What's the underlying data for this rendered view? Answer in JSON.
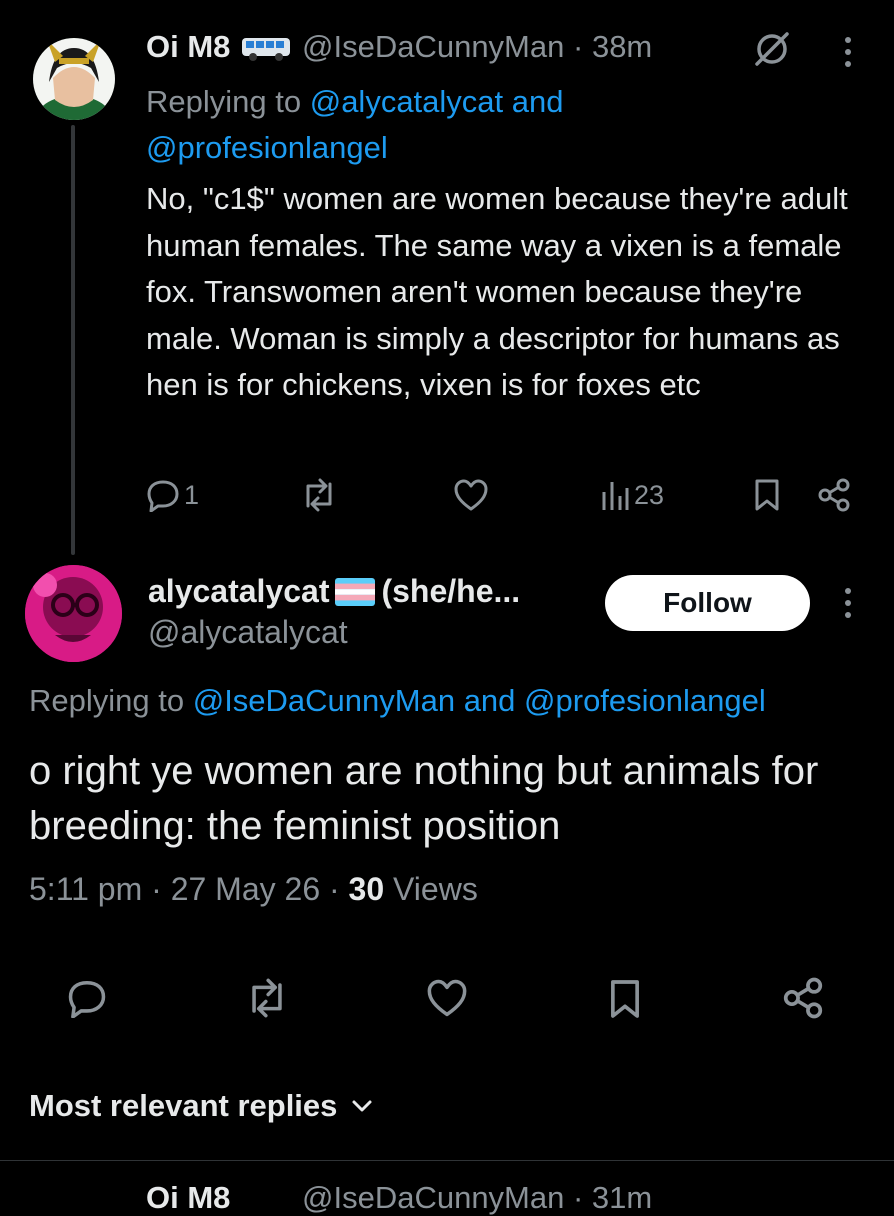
{
  "parent_tweet": {
    "display_name": "Oi M8",
    "name_emoji": "bus",
    "handle": "@IseDaCunnyMan",
    "separator": "·",
    "time": "38m",
    "replying_prefix": "Replying to",
    "replying_line1": "@alycatalycat and",
    "replying_line2": "@profesionlangel",
    "text": "No, \"c1$\" women are women because they're adult human females. The same way a vixen is a female fox. Transwomen aren't women because they're male. Woman is simply a descriptor for humans as hen is for chickens, vixen is for foxes etc",
    "reply_count": "1",
    "views_count": "23"
  },
  "focused_tweet": {
    "display_name": "alycatalycat",
    "name_flag": "transgender-flag",
    "name_suffix": "(she/he...",
    "handle": "@alycatalycat",
    "follow_label": "Follow",
    "replying_prefix": "Replying to",
    "replying_to": "@IseDaCunnyMan and @profesionlangel",
    "text": "o right ye women are nothing but animals for breeding: the feminist position",
    "time": "5:11 pm",
    "date": "27 May 26",
    "sep": "·",
    "views_count": "30",
    "views_label": "Views"
  },
  "replies_sort": {
    "label": "Most relevant replies"
  },
  "next_tweet_peek": {
    "display_name": "Oi M8",
    "handle": "@IseDaCunnyMan · 31m"
  },
  "colors": {
    "background": "#000000",
    "text": "#e7e9ea",
    "secondary": "#8b9298",
    "link": "#1d9bf0"
  }
}
